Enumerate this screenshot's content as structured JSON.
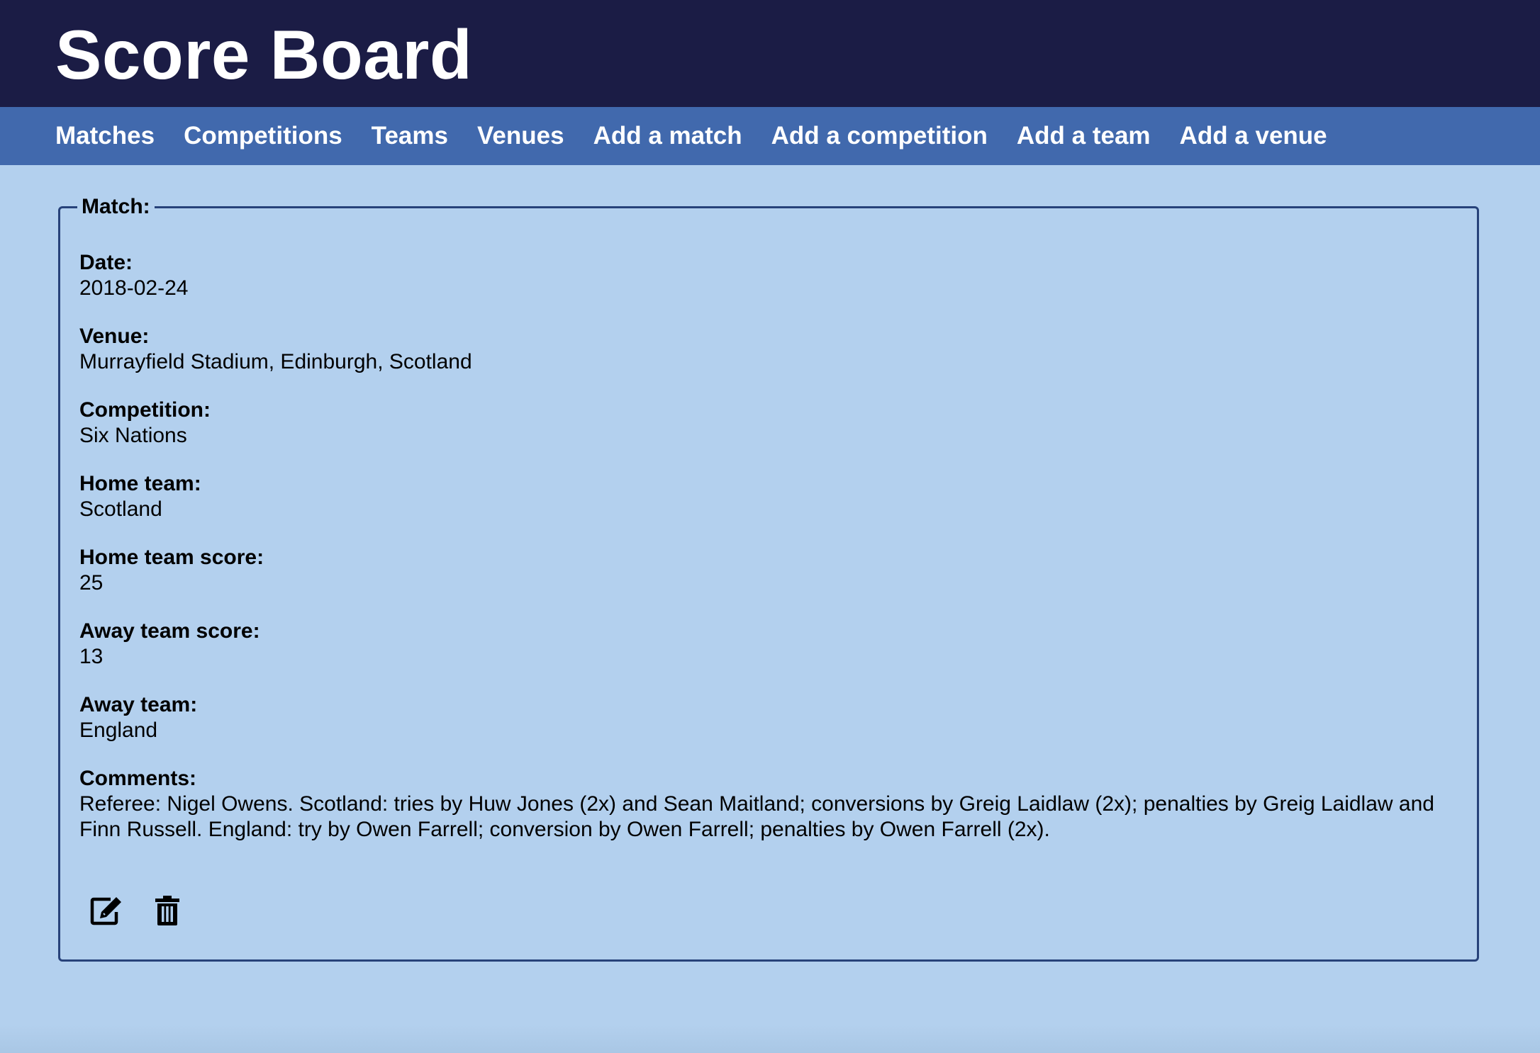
{
  "header": {
    "title": "Score Board"
  },
  "nav": {
    "items": [
      {
        "label": "Matches"
      },
      {
        "label": "Competitions"
      },
      {
        "label": "Teams"
      },
      {
        "label": "Venues"
      },
      {
        "label": "Add a match"
      },
      {
        "label": "Add a competition"
      },
      {
        "label": "Add a team"
      },
      {
        "label": "Add a venue"
      }
    ]
  },
  "match": {
    "legend": "Match:",
    "fields": [
      {
        "label": "Date:",
        "value": "2018-02-24"
      },
      {
        "label": "Venue:",
        "value": "Murrayfield Stadium, Edinburgh, Scotland"
      },
      {
        "label": "Competition:",
        "value": "Six Nations"
      },
      {
        "label": "Home team:",
        "value": "Scotland"
      },
      {
        "label": "Home team score:",
        "value": "25"
      },
      {
        "label": "Away team score:",
        "value": "13"
      },
      {
        "label": "Away team:",
        "value": "England"
      },
      {
        "label": "Comments:",
        "value": "Referee: Nigel Owens. Scotland: tries by Huw Jones (2x) and Sean Maitland; conversions by Greig Laidlaw (2x); penalties by Greig Laidlaw and Finn Russell. England: try by Owen Farrell; conversion by Owen Farrell; penalties by Owen Farrell (2x)."
      }
    ]
  },
  "actions": {
    "edit_icon": "edit-icon",
    "delete_icon": "trash-icon"
  },
  "colors": {
    "header_bg": "#1b1c45",
    "nav_bg": "#4169ad",
    "page_bg": "#b3d0ee",
    "panel_border": "#27427a"
  }
}
